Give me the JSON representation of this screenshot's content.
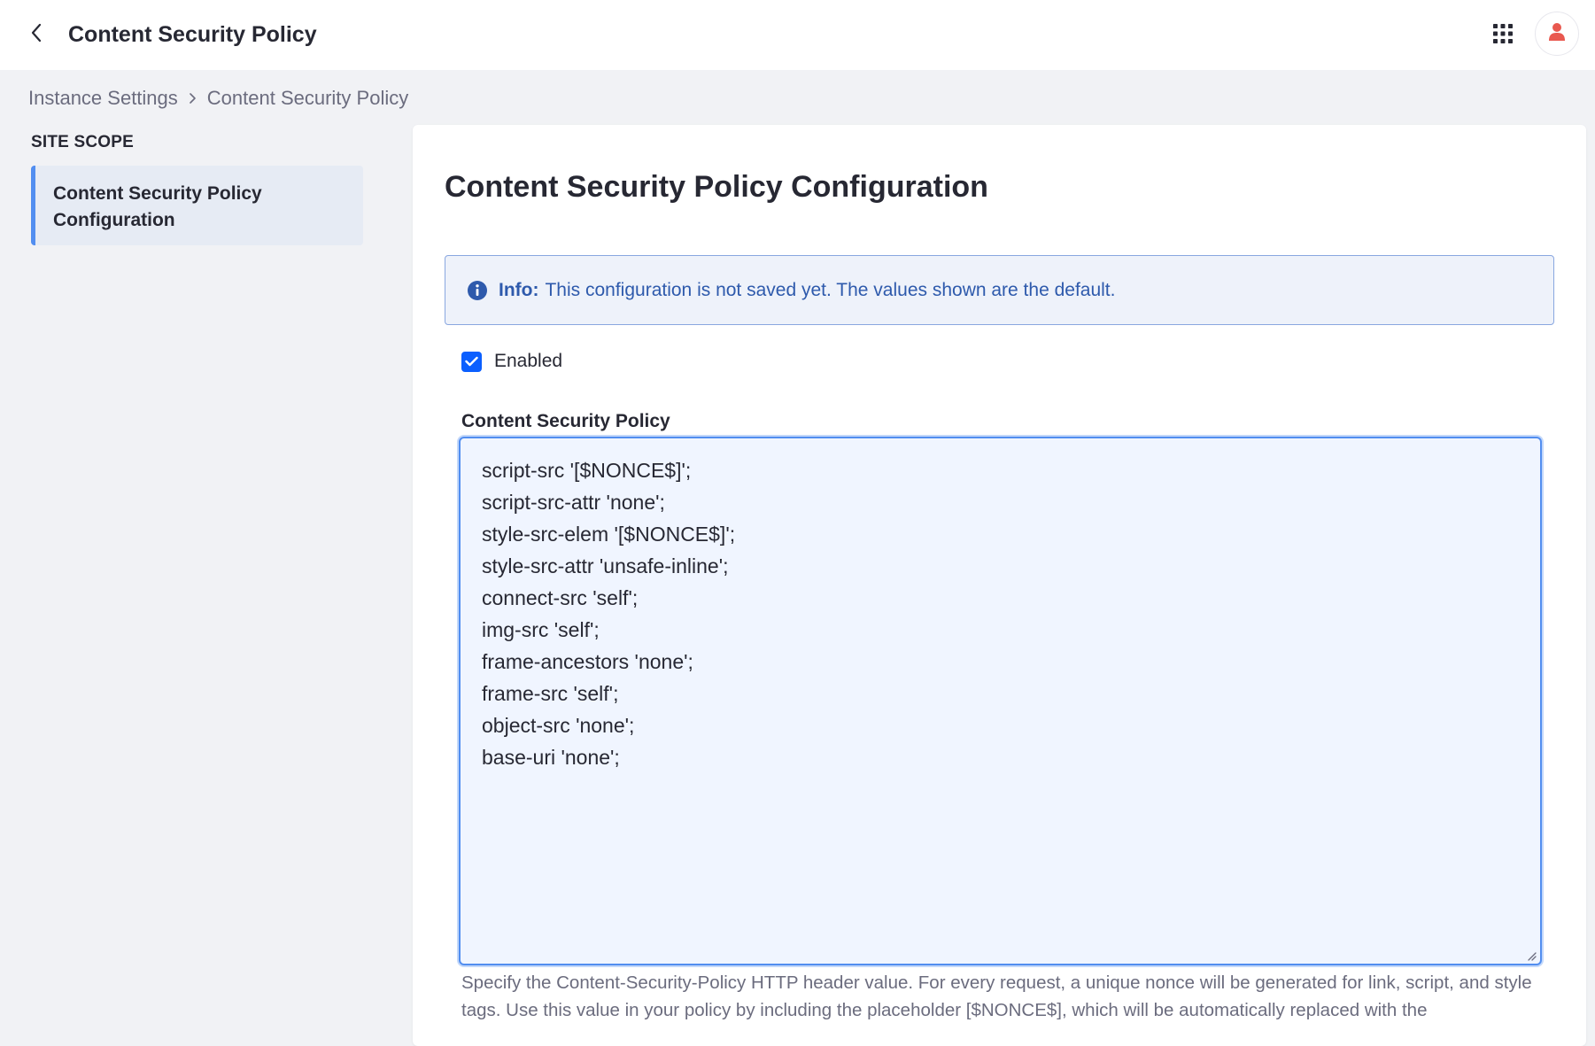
{
  "header": {
    "title": "Content Security Policy",
    "back_icon": "chevron-left-icon",
    "apps_icon": "grid-icon",
    "avatar_icon": "user-icon",
    "avatar_color": "#e9584f"
  },
  "breadcrumb": {
    "items": [
      "Instance Settings",
      "Content Security Policy"
    ]
  },
  "sidebar": {
    "heading": "SITE SCOPE",
    "items": [
      {
        "label": "Content Security Policy Configuration",
        "active": true
      }
    ]
  },
  "main": {
    "title": "Content Security Policy Configuration",
    "alert": {
      "label": "Info:",
      "text": "This configuration is not saved yet. The values shown are the default.",
      "icon": "info-circle-icon",
      "color": "#2e5aac"
    },
    "enabled": {
      "label": "Enabled",
      "checked": true
    },
    "policy_field": {
      "label": "Content Security Policy",
      "value": "script-src '[$NONCE$]';\nscript-src-attr 'none';\nstyle-src-elem '[$NONCE$]';\nstyle-src-attr 'unsafe-inline';\nconnect-src 'self';\nimg-src 'self';\nframe-ancestors 'none';\nframe-src 'self';\nobject-src 'none';\nbase-uri 'none';",
      "help": "Specify the Content-Security-Policy HTTP header value. For every request, a unique nonce will be generated for link, script, and style tags. Use this value in your policy by including the placeholder [$NONCE$], which will be automatically replaced with the"
    }
  },
  "colors": {
    "accent": "#0b5fff",
    "focus_border": "#528ef0",
    "page_bg": "#f1f2f5"
  }
}
